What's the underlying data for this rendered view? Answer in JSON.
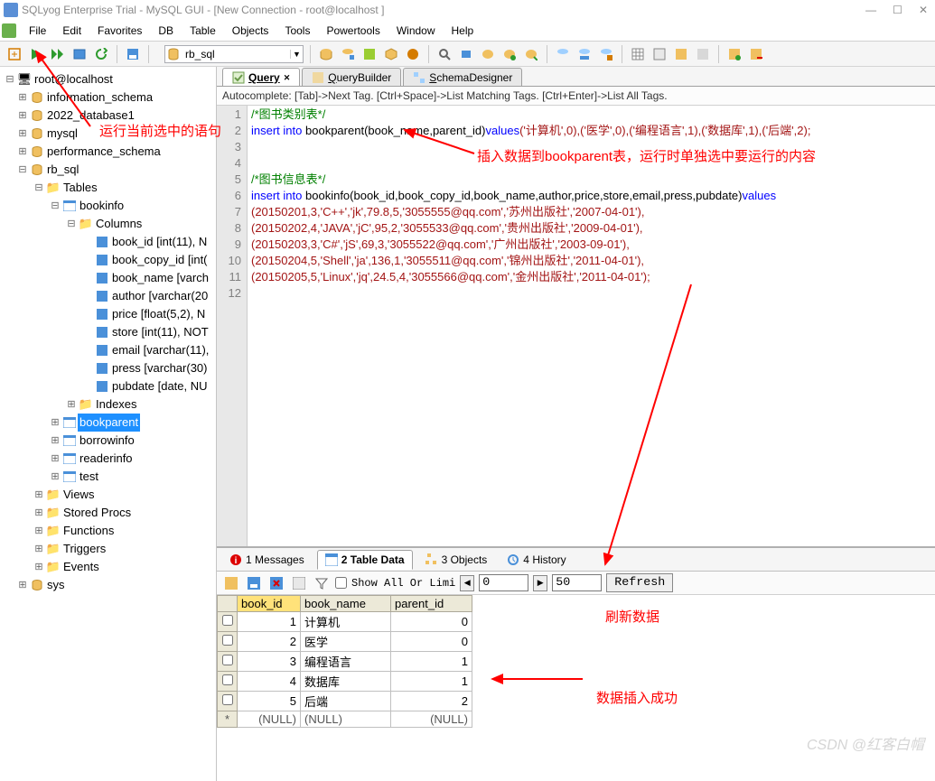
{
  "title": "SQLyog Enterprise Trial - MySQL GUI - [New Connection - root@localhost ]",
  "menu": [
    "File",
    "Edit",
    "Favorites",
    "DB",
    "Table",
    "Objects",
    "Tools",
    "Powertools",
    "Window",
    "Help"
  ],
  "winbtns": {
    "min": "—",
    "max": "☐",
    "close": "✕"
  },
  "dbselect": "rb_sql",
  "sidebar": {
    "root": "root@localhost",
    "dbs": [
      "information_schema",
      "2022_database1",
      "mysql",
      "performance_schema"
    ],
    "rbsql": "rb_sql",
    "tables": "Tables",
    "bookinfo": "bookinfo",
    "columns_label": "Columns",
    "columns": [
      "book_id [int(11), N",
      "book_copy_id [int(",
      "book_name [varch",
      "author [varchar(20",
      "price [float(5,2), N",
      "store [int(11), NOT",
      "email [varchar(11),",
      "press [varchar(30)",
      "pubdate [date, NU"
    ],
    "indexes": "Indexes",
    "other_tables": [
      "bookparent",
      "borrowinfo",
      "readerinfo",
      "test"
    ],
    "folders": [
      "Views",
      "Stored Procs",
      "Functions",
      "Triggers",
      "Events"
    ],
    "sys": "sys"
  },
  "tabs": [
    {
      "n": "Q",
      "label": "uery"
    },
    {
      "n": "Q",
      "label": "ueryBuilder"
    },
    {
      "n": "S",
      "label": "chemaDesigner"
    }
  ],
  "autocomplete": "Autocomplete: [Tab]->Next Tag. [Ctrl+Space]->List Matching Tags. [Ctrl+Enter]->List All Tags.",
  "annotations": {
    "run": "运行当前选中的语句",
    "insert": "插入数据到bookparent表，运行时单独选中要运行的内容",
    "refresh": "刷新数据",
    "success": "数据插入成功"
  },
  "code": {
    "c1": "/*图书类别表*/",
    "kw_insert": "insert",
    "kw_into": "into",
    "kw_values": "values",
    "fn_bp": "bookparent(book_name,parent_id)",
    "bp_v": "('计算机',0),('医学',0),('编程语言',1),('数据库',1),('后端',2);",
    "c2": "/*图书信息表*/",
    "fn_bi": "bookinfo(book_id,book_copy_id,book_name,author,price,store,email,press,pubdate)",
    "r7": "(20150201,3,'C++','jk',79.8,5,'3055555@qq.com','苏州出版社','2007-04-01'),",
    "r8": "(20150202,4,'JAVA','jC',95,2,'3055533@qq.com','贵州出版社','2009-04-01'),",
    "r9": "(20150203,3,'C#','jS',69,3,'3055522@qq.com','广州出版社','2003-09-01'),",
    "r10": "(20150204,5,'Shell','ja',136,1,'3055511@qq.com','锦州出版社','2011-04-01'),",
    "r11": "(20150205,5,'Linux','jq',24.5,4,'3055566@qq.com','金州出版社','2011-04-01');"
  },
  "bottom_tabs": [
    {
      "n": "1",
      "label": "Messages"
    },
    {
      "n": "2",
      "label": "Table Data"
    },
    {
      "n": "3",
      "label": "Objects"
    },
    {
      "n": "4",
      "label": "History"
    }
  ],
  "bt": {
    "showall": "Show All Or  Limi",
    "from": "0",
    "to": "50",
    "refresh": "Refresh"
  },
  "grid": {
    "headers": [
      "book_id",
      "book_name",
      "parent_id"
    ],
    "rows": [
      {
        "id": "1",
        "name": "计算机",
        "pid": "0"
      },
      {
        "id": "2",
        "name": "医学",
        "pid": "0"
      },
      {
        "id": "3",
        "name": "编程语言",
        "pid": "1"
      },
      {
        "id": "4",
        "name": "数据库",
        "pid": "1"
      },
      {
        "id": "5",
        "name": "后端",
        "pid": "2"
      }
    ],
    "null": "(NULL)",
    "star": "*"
  },
  "watermark": "CSDN @红客白帽"
}
